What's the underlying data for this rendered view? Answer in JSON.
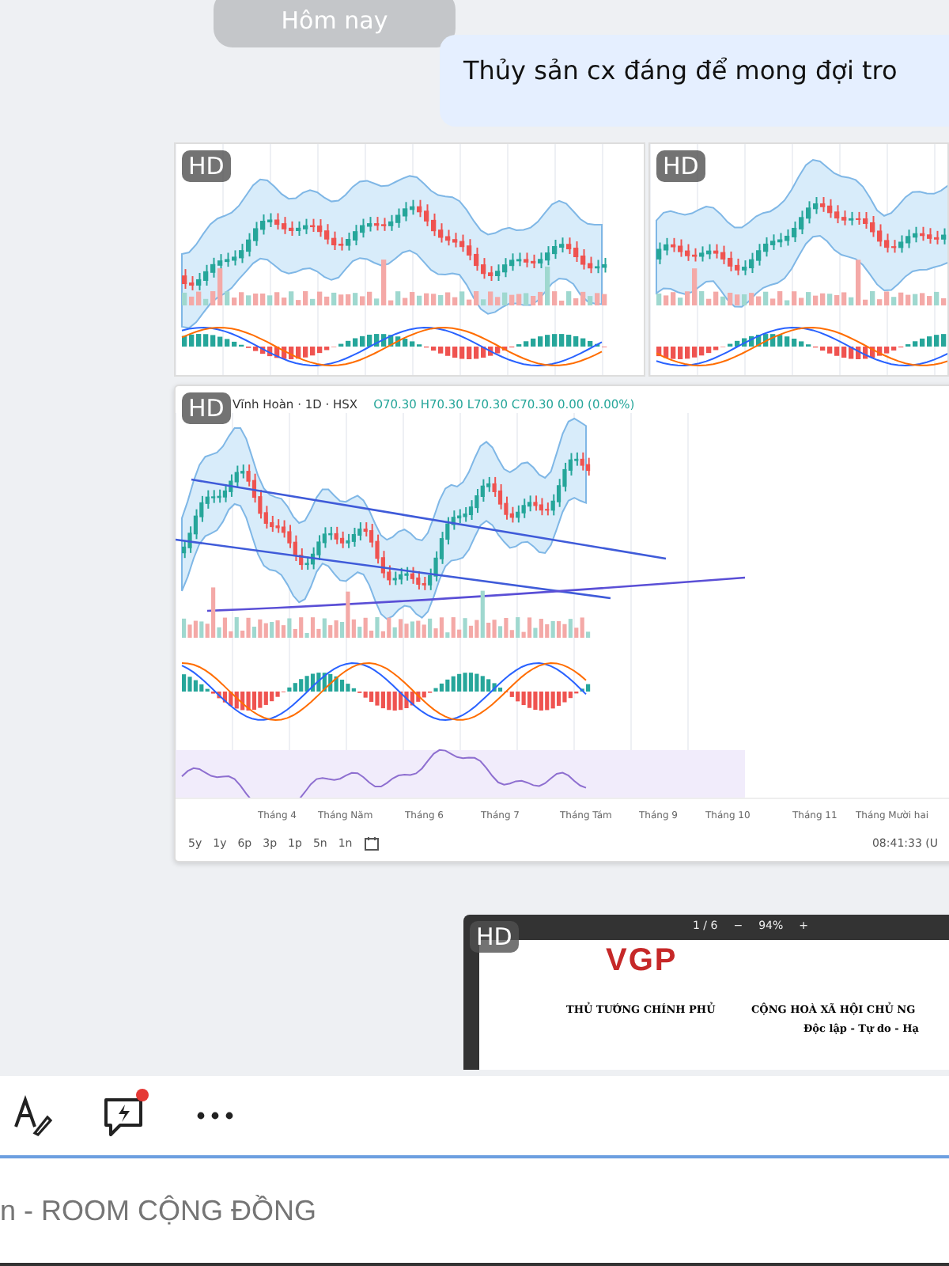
{
  "date_divider": "Hôm nay",
  "message": {
    "text": "Thủy sản cx đáng để mong đợi tro"
  },
  "attachments": [
    {
      "kind": "chart-thumb",
      "badge": "HD"
    },
    {
      "kind": "chart-thumb",
      "badge": "HD"
    },
    {
      "kind": "chart",
      "badge": "HD",
      "title": "Vĩnh Hoàn · 1D · HSX",
      "ohlc": "O70.30 H70.30 L70.30 C70.30 0.00 (0.00%)",
      "months": [
        "Tháng 4",
        "Tháng Năm",
        "Tháng 6",
        "Tháng 7",
        "Tháng Tám",
        "Tháng 9",
        "Tháng 10",
        "Tháng 11",
        "Tháng Mười hai"
      ],
      "ranges": [
        "5y",
        "1y",
        "6p",
        "3p",
        "1p",
        "5n",
        "1n"
      ],
      "time": "08:41:33 (U"
    },
    {
      "kind": "document",
      "badge": "HD",
      "page": "1 / 6",
      "zoom_out": "−",
      "zoom": "94%",
      "zoom_in": "+",
      "logo": "VGP",
      "left_heading": "THỦ TƯỚNG CHÍNH PHỦ",
      "right_heading": "CỘNG HOÀ XÃ HỘI CHỦ NG",
      "motto": "Độc lập - Tự do - Hạ"
    }
  ],
  "toolbar": {
    "notification_dot": true
  },
  "composer": {
    "placeholder": "n - ROOM CỘNG ĐỒNG"
  }
}
